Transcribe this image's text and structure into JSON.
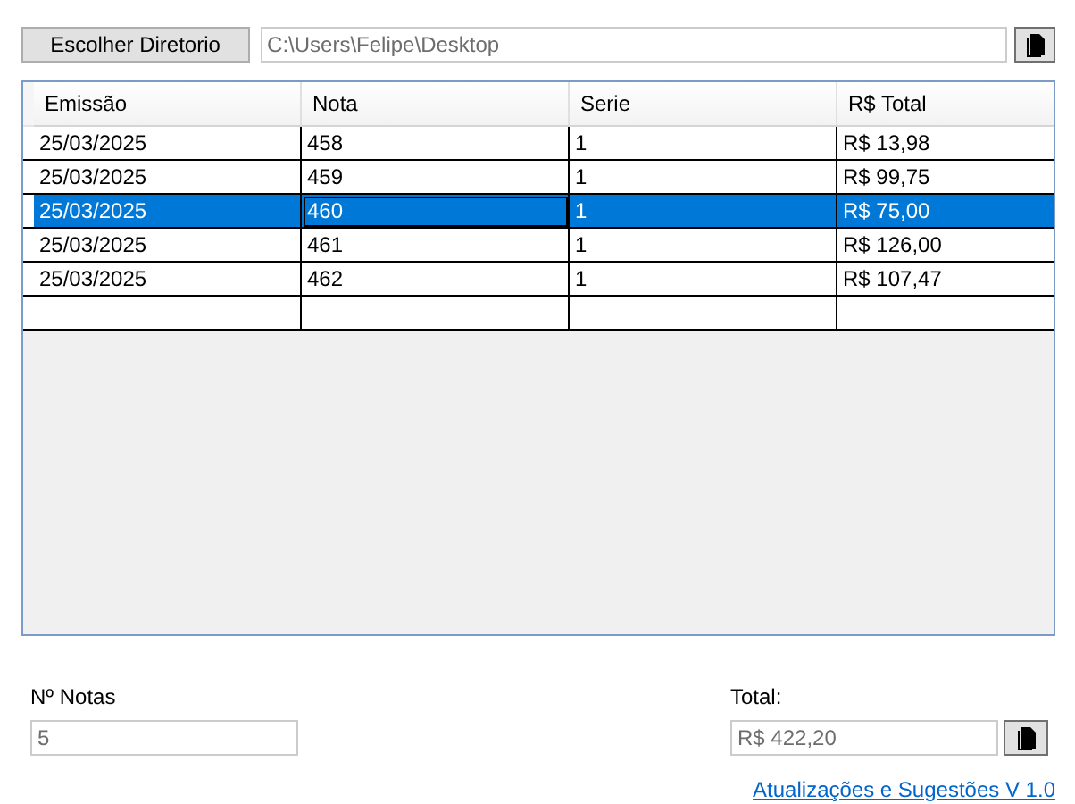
{
  "directory_button": "Escolher Diretorio",
  "path_field": {
    "value": "C:\\Users\\Felipe\\Desktop",
    "disabled": true
  },
  "table": {
    "columns": [
      "Emissão",
      "Nota",
      "Serie",
      "R$ Total"
    ],
    "rows": [
      {
        "cells": [
          "25/03/2025",
          "458",
          "1",
          "R$ 13,98"
        ],
        "selected": false
      },
      {
        "cells": [
          "25/03/2025",
          "459",
          "1",
          "R$ 99,75"
        ],
        "selected": false
      },
      {
        "cells": [
          "25/03/2025",
          "460",
          "1",
          "R$ 75,00"
        ],
        "selected": true
      },
      {
        "cells": [
          "25/03/2025",
          "461",
          "1",
          "R$ 126,00"
        ],
        "selected": false
      },
      {
        "cells": [
          "25/03/2025",
          "462",
          "1",
          "R$ 107,47"
        ],
        "selected": false
      }
    ]
  },
  "count": {
    "label": "Nº Notas",
    "value": "5",
    "disabled": true
  },
  "total": {
    "label": "Total:",
    "value": "R$ 422,20",
    "disabled": true
  },
  "link": "Atualizações e Sugestões V 1.0"
}
